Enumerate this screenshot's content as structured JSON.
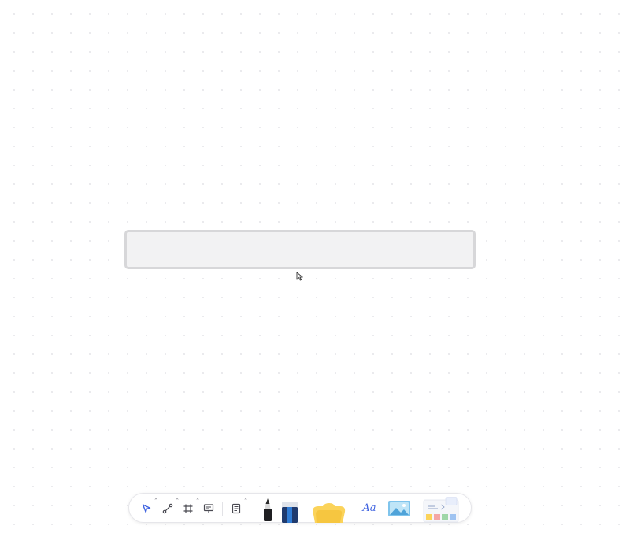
{
  "canvas": {
    "background": "#ffffff",
    "dot_color": "#e9e9ec"
  },
  "selected_block": {
    "text": "",
    "fill": "#f2f2f3",
    "border": "#d7d7d9"
  },
  "toolbar": {
    "tools": [
      {
        "id": "select",
        "icon": "pointer-arrow-icon",
        "active": true
      },
      {
        "id": "connector",
        "icon": "connector-icon"
      },
      {
        "id": "frame",
        "icon": "frame-icon"
      },
      {
        "id": "presentation",
        "icon": "presentation-icon"
      },
      {
        "id": "note",
        "icon": "note-icon"
      },
      {
        "id": "pen",
        "icon": "pen-icon"
      },
      {
        "id": "eraser",
        "icon": "eraser-icon"
      },
      {
        "id": "shape",
        "icon": "shape-icon"
      },
      {
        "id": "text",
        "icon": "text-icon"
      },
      {
        "id": "image",
        "icon": "image-icon"
      },
      {
        "id": "templates",
        "icon": "templates-icon"
      }
    ],
    "text_tool_label": "Aa",
    "accent": "#3f63e0",
    "shape_color": "#fbd35a"
  }
}
